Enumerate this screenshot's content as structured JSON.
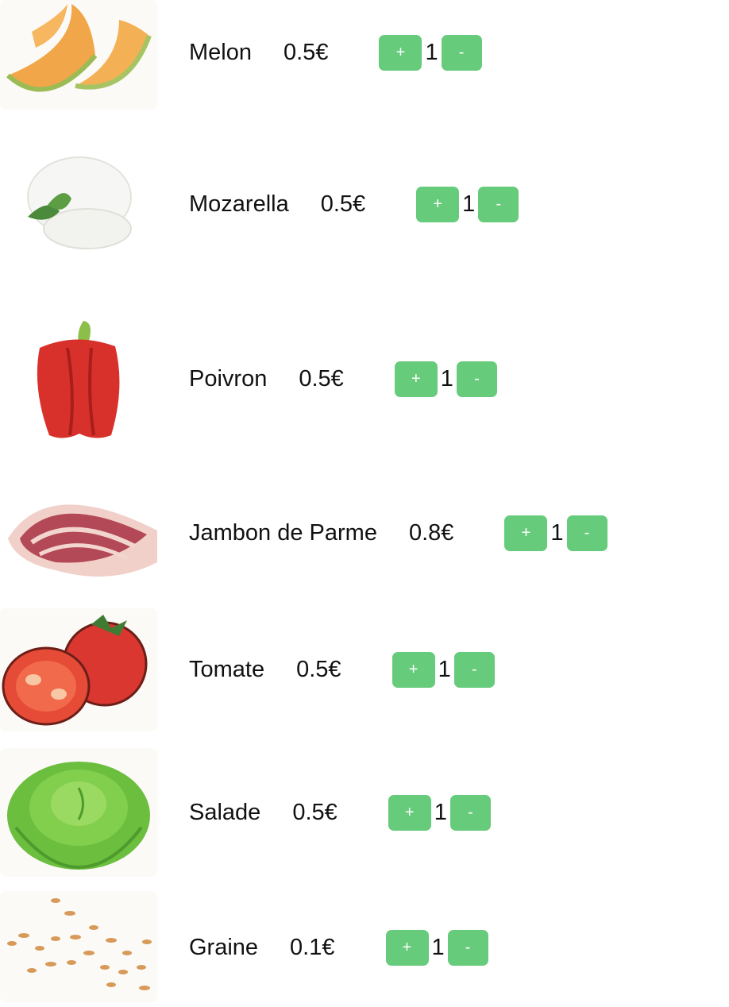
{
  "items": [
    {
      "name": "Melon",
      "price": "0.5€",
      "qty": "1",
      "plus": "+",
      "minus": "-",
      "image": "melon"
    },
    {
      "name": "Mozarella",
      "price": "0.5€",
      "qty": "1",
      "plus": "+",
      "minus": "-",
      "image": "mozzarella"
    },
    {
      "name": "Poivron",
      "price": "0.5€",
      "qty": "1",
      "plus": "+",
      "minus": "-",
      "image": "bell-pepper"
    },
    {
      "name": "Jambon de Parme",
      "price": "0.8€",
      "qty": "1",
      "plus": "+",
      "minus": "-",
      "image": "parma-ham"
    },
    {
      "name": "Tomate",
      "price": "0.5€",
      "qty": "1",
      "plus": "+",
      "minus": "-",
      "image": "tomato"
    },
    {
      "name": "Salade",
      "price": "0.5€",
      "qty": "1",
      "plus": "+",
      "minus": "-",
      "image": "lettuce"
    },
    {
      "name": "Graine",
      "price": "0.1€",
      "qty": "1",
      "plus": "+",
      "minus": "-",
      "image": "seeds"
    }
  ],
  "colors": {
    "button": "#66cb7a",
    "button_text": "#ffffff",
    "text": "#111111"
  }
}
